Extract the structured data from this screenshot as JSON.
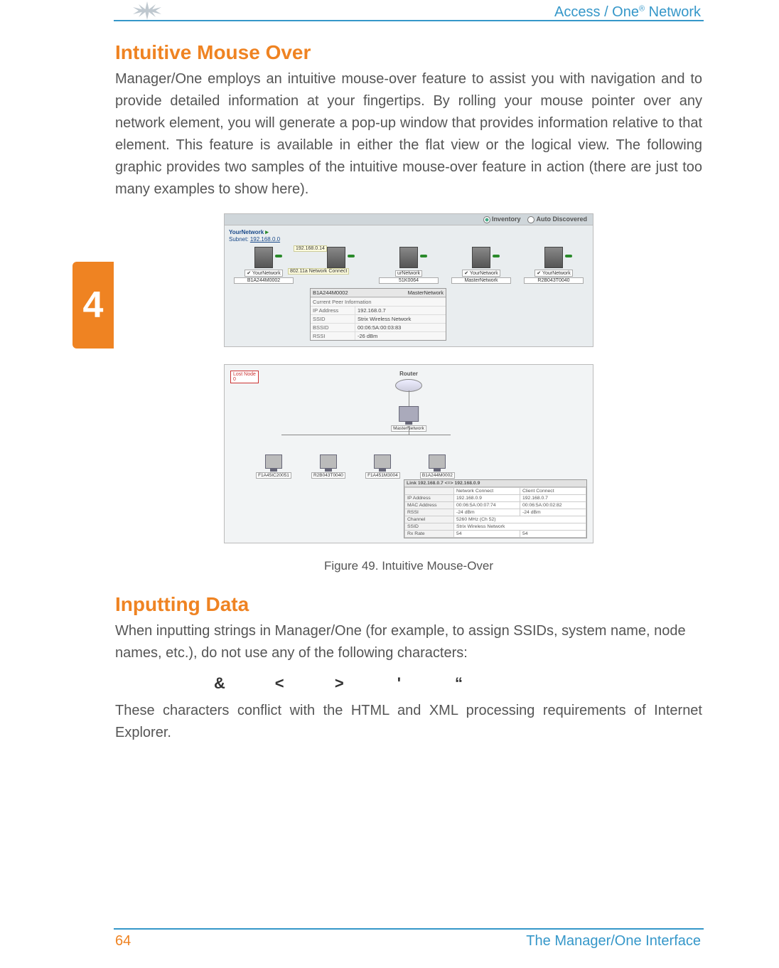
{
  "header": {
    "product_line": "Access / One",
    "reg_mark": "®",
    "product_suffix": " Network"
  },
  "chapter_tab": "4",
  "section1": {
    "title": "Intuitive Mouse Over",
    "body": "Manager/One employs an intuitive mouse-over feature to assist you with navigation and to provide detailed information at your fingertips. By rolling your mouse pointer over any network element, you will generate a pop-up window that provides information relative to that element. This feature is available in either the flat view or the logical view. The following graphic provides two samples of the intuitive mouse-over feature in action (there are just too many examples to show here)."
  },
  "figure_top": {
    "radios": {
      "inventory": "Inventory",
      "auto": "Auto Discovered"
    },
    "network_label": "YourNetwork",
    "subnet_prefix": "Subnet: ",
    "subnet_value": "192.168.0.0",
    "tooltip_ip": "192.168.0.14",
    "tooltip_type": "802.11a Network Connect",
    "nodes": [
      {
        "check": "YourNetwork",
        "id": "B1A244M0002"
      },
      {
        "check": "–",
        "id": "–"
      },
      {
        "check": "urNetwork",
        "id": "51K0064"
      },
      {
        "check": "YourNetwork",
        "id": "MasterNetwork"
      },
      {
        "check": "YourNetwork",
        "id": "R2B043T0040"
      }
    ],
    "popup": {
      "title_left": "B1A244M0002",
      "title_right": "MasterNetwork",
      "section": "Current Peer Information",
      "rows": [
        {
          "k": "IP Address",
          "v": "192.168.0.7"
        },
        {
          "k": "SSID",
          "v": "Strix Wireless Network"
        },
        {
          "k": "BSSID",
          "v": "00:06:5A:00:03:83"
        },
        {
          "k": "RSSI",
          "v": "-26 dBm"
        }
      ]
    }
  },
  "figure_bottom": {
    "lost_node_label": "Lost Node",
    "lost_node_count": "0",
    "router_label": "Router",
    "master_label": "MasterNetwork",
    "children": [
      "F1A45IC20051",
      "R2B043T0040",
      "F1A451M3004",
      "B1A244M0002"
    ],
    "popup": {
      "header": "Link 192.168.0.7 <=> 192.168.0.9",
      "cols": [
        "Network Connect",
        "Client Connect"
      ],
      "rows": [
        {
          "k": "IP Address",
          "c1": "192.168.0.9",
          "c2": "192.168.0.7"
        },
        {
          "k": "MAC Address",
          "c1": "00:06:5A:00:07:74",
          "c2": "00:06:5A:00:02:82"
        },
        {
          "k": "RSSI",
          "c1": "-24 dBm",
          "c2": "-24 dBm"
        },
        {
          "k": "Channel",
          "c1": "5260 MHz (Ch 52)",
          "c2": ""
        },
        {
          "k": "SSID",
          "c1": "Strix Wireless Network",
          "c2": ""
        },
        {
          "k": "Rx Rate",
          "c1": "54",
          "c2": "54"
        }
      ]
    }
  },
  "figure_caption": "Figure 49. Intuitive Mouse-Over",
  "section2": {
    "title": "Inputting Data",
    "body1": "When inputting strings in Manager/One (for example, to assign SSIDs, system name, node names, etc.), do not use any of the following characters:",
    "chars": [
      "&",
      "<",
      ">",
      "'",
      "“"
    ],
    "body2": "These characters conflict with the HTML and XML processing requirements of Internet Explorer."
  },
  "footer": {
    "page": "64",
    "title": "The Manager/One Interface"
  }
}
